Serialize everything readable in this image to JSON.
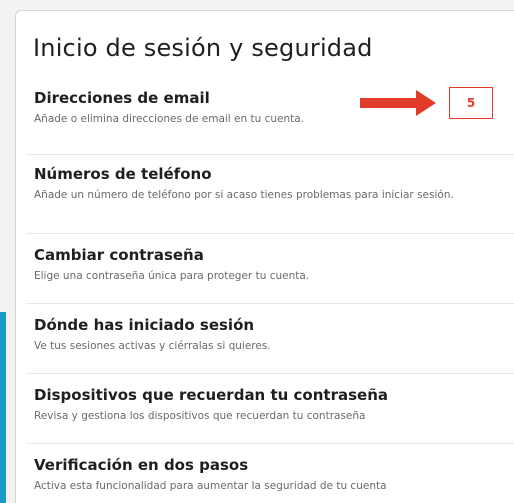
{
  "page": {
    "title": "Inicio de sesión y seguridad"
  },
  "items": [
    {
      "title": "Direcciones de email",
      "description": "Añade o elimina direcciones de email en tu cuenta."
    },
    {
      "title": "Números de teléfono",
      "description": "Añade un número de teléfono por si acaso tienes problemas para iniciar sesión."
    },
    {
      "title": "Cambiar contraseña",
      "description": "Elige una contraseña única para proteger tu cuenta."
    },
    {
      "title": "Dónde has iniciado sesión",
      "description": "Ve tus sesiones activas y ciérralas si quieres."
    },
    {
      "title": "Dispositivos que recuerdan tu contraseña",
      "description": "Revisa y gestiona los dispositivos que recuerdan tu contraseña"
    },
    {
      "title": "Verificación en dos pasos",
      "description": "Activa esta funcionalidad para aumentar la seguridad de tu cuenta"
    }
  ],
  "annotation": {
    "step_label": "5",
    "arrow_color": "#e23b2a"
  },
  "colors": {
    "accent_bar": "#1c9bc8"
  }
}
